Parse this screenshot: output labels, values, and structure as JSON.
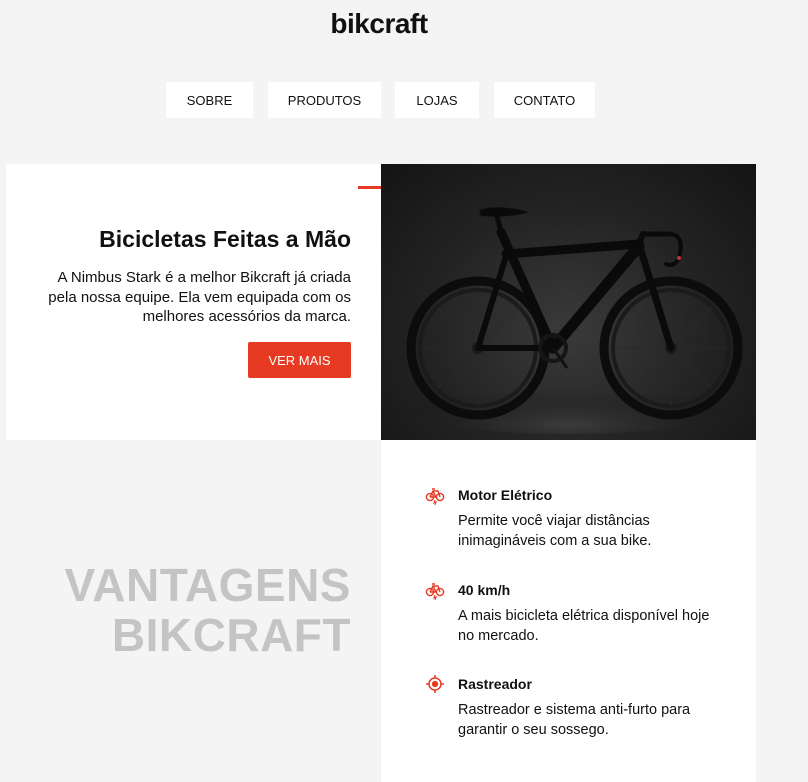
{
  "brand": {
    "logo": "bikcraft"
  },
  "nav": {
    "items": [
      "SOBRE",
      "PRODUTOS",
      "LOJAS",
      "CONTATO"
    ]
  },
  "hero": {
    "title": "Bicicletas Feitas a Mão",
    "description": "A Nimbus Stark é a melhor Bikcraft já criada pela nossa equipe. Ela vem equipada com os melhores acessórios da marca.",
    "button": "VER MAIS",
    "accent_color": "#e63a23"
  },
  "vantagens": {
    "line1": "VANTAGENS",
    "line2": "BIKCRAFT",
    "items": [
      {
        "icon": "electric-bike-icon",
        "title": "Motor Elétrico",
        "description": "Permite você viajar distâncias inimagináveis com a sua bike."
      },
      {
        "icon": "electric-bike-icon",
        "title": "40 km/h",
        "description": "A mais bicicleta elétrica disponível hoje no mercado."
      },
      {
        "icon": "tracker-icon",
        "title": "Rastreador",
        "description": "Rastreador e sistema anti-furto para garantir o seu sossego."
      }
    ]
  }
}
